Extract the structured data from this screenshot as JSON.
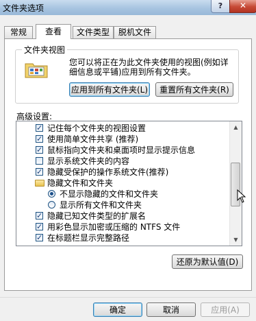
{
  "window": {
    "title": "文件夹选项",
    "help_label": "?",
    "close_label": "✕"
  },
  "tabs": [
    {
      "label": "常规"
    },
    {
      "label": "查看"
    },
    {
      "label": "文件类型"
    },
    {
      "label": "脱机文件"
    }
  ],
  "folder_views": {
    "group_label": "文件夹视图",
    "description": "您可以将正在为此文件夹使用的视图(例如详细信息或平铺)应用到所有文件夹。",
    "apply_all_button": "应用到所有文件夹(L)",
    "reset_all_button": "重置所有文件夹(R)"
  },
  "advanced": {
    "label": "高级设置:",
    "items": [
      {
        "type": "checkbox",
        "checked": true,
        "label": "记住每个文件夹的视图设置"
      },
      {
        "type": "checkbox",
        "checked": true,
        "label": "使用简单文件共享 (推荐)"
      },
      {
        "type": "checkbox",
        "checked": true,
        "label": "鼠标指向文件夹和桌面项时显示提示信息"
      },
      {
        "type": "checkbox",
        "checked": false,
        "label": "显示系统文件夹的内容"
      },
      {
        "type": "checkbox",
        "checked": true,
        "label": "隐藏受保护的操作系统文件(推荐)"
      },
      {
        "type": "folder",
        "label": "隐藏文件和文件夹"
      },
      {
        "type": "radio",
        "checked": true,
        "label": "不显示隐藏的文件和文件夹"
      },
      {
        "type": "radio",
        "checked": false,
        "label": "显示所有文件和文件夹"
      },
      {
        "type": "checkbox",
        "checked": true,
        "label": "隐藏已知文件类型的扩展名"
      },
      {
        "type": "checkbox",
        "checked": true,
        "label": "用彩色显示加密或压缩的 NTFS 文件"
      },
      {
        "type": "checkbox",
        "checked": true,
        "label": "在标题栏显示完整路径"
      }
    ],
    "restore_defaults_button": "还原为默认值(D)"
  },
  "footer": {
    "ok_label": "确定",
    "cancel_label": "取消",
    "apply_label": "应用(A)"
  }
}
